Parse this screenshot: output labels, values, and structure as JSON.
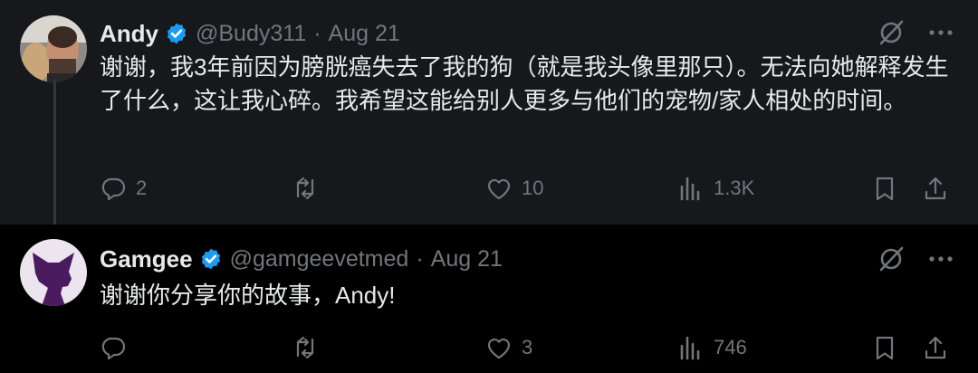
{
  "tweets": [
    {
      "name": "Andy",
      "handle": "@Budy311",
      "separator": "·",
      "date": "Aug 21",
      "text": "谢谢，我3年前因为膀胱癌失去了我的狗（就是我头像里那只）。无法向她解释发生了什么，这让我心碎。我希望这能给别人更多与他们的宠物/家人相处的时间。",
      "replies": "2",
      "retweets": "",
      "likes": "10",
      "views": "1.3K"
    },
    {
      "name": "Gamgee",
      "handle": "@gamgeevetmed",
      "separator": "·",
      "date": "Aug 21",
      "text": "谢谢你分享你的故事，Andy!",
      "replies": "",
      "retweets": "",
      "likes": "3",
      "views": "746"
    }
  ],
  "colors": {
    "verified": "#1d9bf0",
    "muted": "#71767b",
    "text": "#e7e9ea",
    "highlighted_bg": "#16181c",
    "gamgee_avatar_bg": "#ece4ee",
    "gamgee_dog": "#4a1b5e"
  },
  "icons": [
    "verified-badge-icon",
    "grok-icon",
    "more-icon",
    "reply-icon",
    "retweet-icon",
    "like-icon",
    "views-icon",
    "bookmark-icon",
    "share-icon"
  ]
}
